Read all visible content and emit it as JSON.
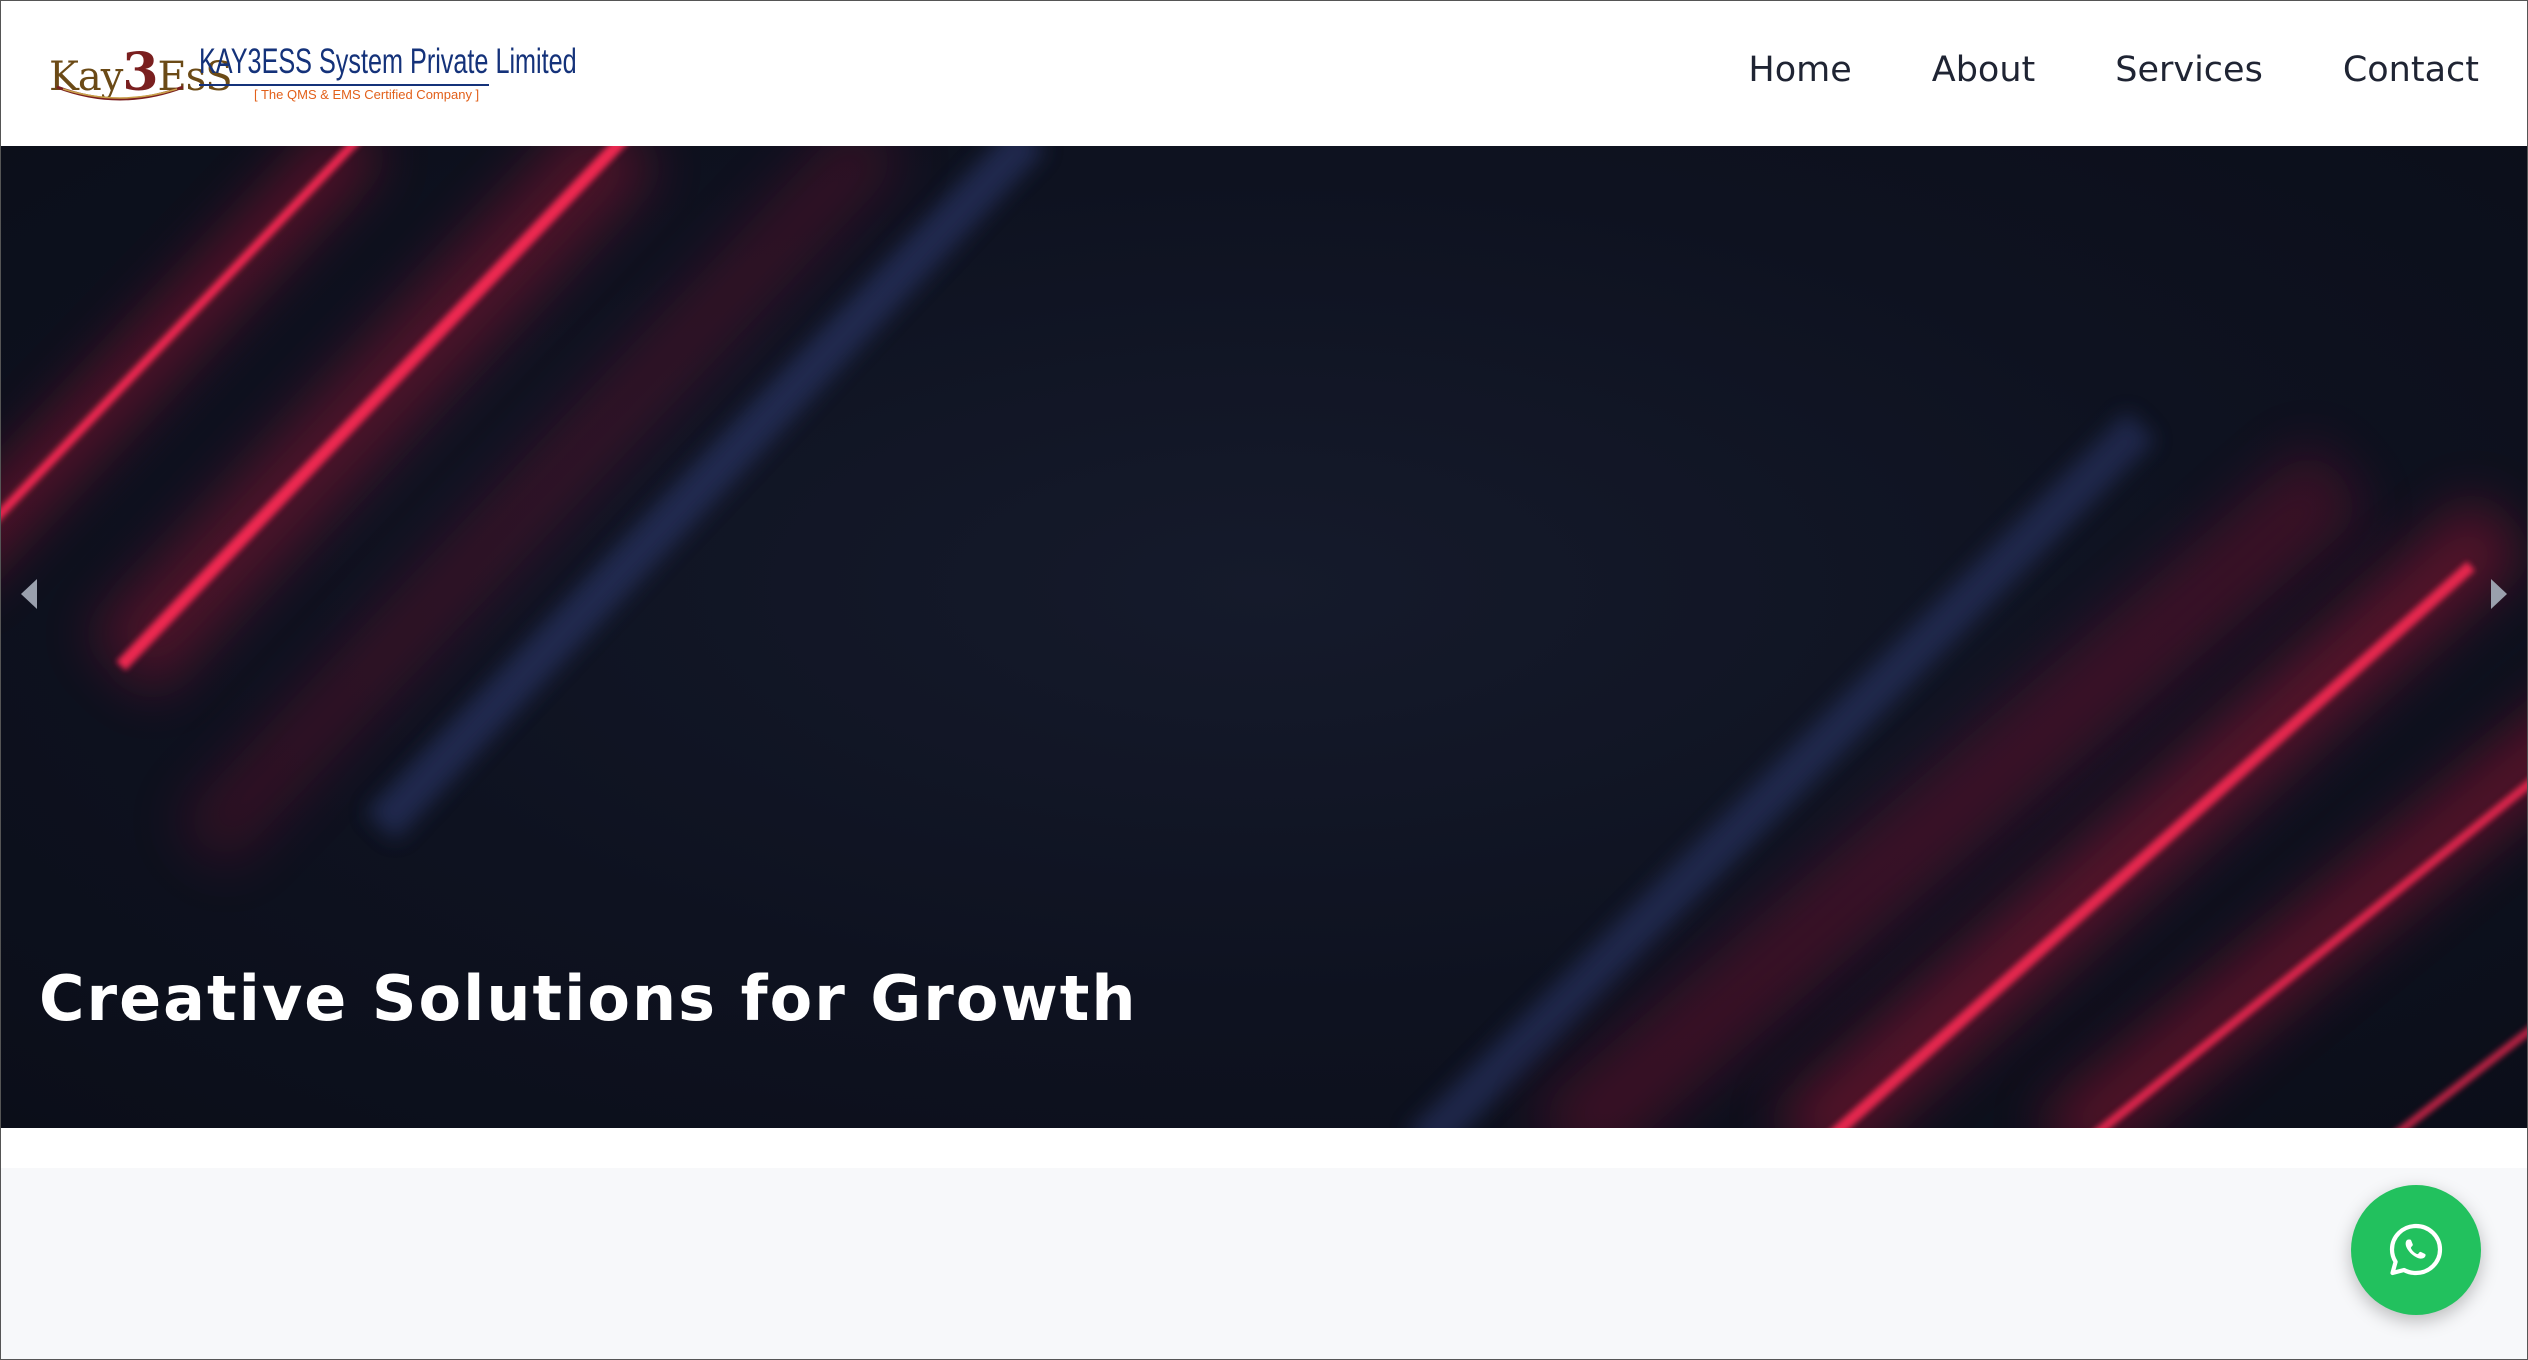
{
  "header": {
    "logo": {
      "mark_left": "Kay",
      "mark_three": "3",
      "mark_right": "EsS",
      "name": "KAY3ESS System Private Limited",
      "tagline": "[ The QMS & EMS Certified Company ]"
    },
    "nav": [
      {
        "label": "Home"
      },
      {
        "label": "About"
      },
      {
        "label": "Services"
      },
      {
        "label": "Contact"
      }
    ]
  },
  "hero": {
    "title": "Creative Solutions for Growth",
    "prev_icon": "chevron-left-icon",
    "next_icon": "chevron-right-icon"
  },
  "floating": {
    "whatsapp_icon": "whatsapp-icon"
  },
  "colors": {
    "hero_background": "#0e1220",
    "streak_red": "#e0173f",
    "streak_blue": "#24305e",
    "nav_text": "#1f2433",
    "whatsapp_green": "#22c15e"
  }
}
